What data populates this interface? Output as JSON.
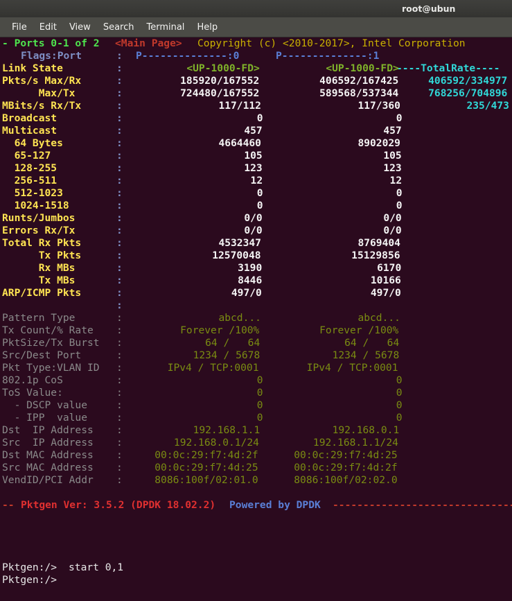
{
  "window": {
    "title": "root@ubun",
    "menu": [
      "File",
      "Edit",
      "View",
      "Search",
      "Terminal",
      "Help"
    ]
  },
  "colors": {
    "background": "#2b0a1e",
    "green": "#4ee44e",
    "yellow": "#ffe452",
    "cyan": "#30d7d7",
    "white": "#f4f4f4",
    "olive": "#c9b100",
    "gray": "#8a8a8a",
    "red": "#c0392b",
    "blue": "#5a7fd6"
  },
  "header": {
    "ports": "- Ports 0-1 of 2",
    "page": "<Main Page>",
    "copyright": "Copyright (c) <2010-2017>, Intel Corporation"
  },
  "flags": {
    "label": "Flags:Port",
    "colon": ":",
    "port0": "P--------------:0",
    "port1": "P--------------:1"
  },
  "columns": {
    "total_rate_header": "----TotalRate----"
  },
  "stats": [
    {
      "label": "Link State",
      "colon": ":",
      "p0": "<UP-1000-FD>",
      "p1": "<UP-1000-FD>",
      "total": "",
      "label_class": "c-yellow",
      "value_class": "c-grn2"
    },
    {
      "label": "Pkts/s Max/Rx",
      "colon": ":",
      "p0": "185920/167552",
      "p1": "406592/167425",
      "total": "406592/334977",
      "label_class": "c-yellow",
      "value_class": "c-white"
    },
    {
      "label": "      Max/Tx",
      "colon": ":",
      "p0": "724480/167552",
      "p1": "589568/537344",
      "total": "768256/704896",
      "label_class": "c-yellow",
      "value_class": "c-white"
    },
    {
      "label": "MBits/s Rx/Tx",
      "colon": ":",
      "p0": "117/112",
      "p1": "117/360",
      "total": "235/473",
      "label_class": "c-yellow",
      "value_class": "c-white"
    },
    {
      "label": "Broadcast",
      "colon": ":",
      "p0": "0",
      "p1": "0",
      "total": "",
      "label_class": "c-yellow",
      "value_class": "c-white"
    },
    {
      "label": "Multicast",
      "colon": ":",
      "p0": "457",
      "p1": "457",
      "total": "",
      "label_class": "c-yellow",
      "value_class": "c-white"
    },
    {
      "label": "  64 Bytes",
      "colon": ":",
      "p0": "4664460",
      "p1": "8902029",
      "total": "",
      "label_class": "c-yellow",
      "value_class": "c-white"
    },
    {
      "label": "  65-127",
      "colon": ":",
      "p0": "105",
      "p1": "105",
      "total": "",
      "label_class": "c-yellow",
      "value_class": "c-white"
    },
    {
      "label": "  128-255",
      "colon": ":",
      "p0": "123",
      "p1": "123",
      "total": "",
      "label_class": "c-yellow",
      "value_class": "c-white"
    },
    {
      "label": "  256-511",
      "colon": ":",
      "p0": "12",
      "p1": "12",
      "total": "",
      "label_class": "c-yellow",
      "value_class": "c-white"
    },
    {
      "label": "  512-1023",
      "colon": ":",
      "p0": "0",
      "p1": "0",
      "total": "",
      "label_class": "c-yellow",
      "value_class": "c-white"
    },
    {
      "label": "  1024-1518",
      "colon": ":",
      "p0": "0",
      "p1": "0",
      "total": "",
      "label_class": "c-yellow",
      "value_class": "c-white"
    },
    {
      "label": "Runts/Jumbos",
      "colon": ":",
      "p0": "0/0",
      "p1": "0/0",
      "total": "",
      "label_class": "c-yellow",
      "value_class": "c-white"
    },
    {
      "label": "Errors Rx/Tx",
      "colon": ":",
      "p0": "0/0",
      "p1": "0/0",
      "total": "",
      "label_class": "c-yellow",
      "value_class": "c-white"
    },
    {
      "label": "Total Rx Pkts",
      "colon": ":",
      "p0": "4532347",
      "p1": "8769404",
      "total": "",
      "label_class": "c-yellow",
      "value_class": "c-white"
    },
    {
      "label": "      Tx Pkts",
      "colon": ":",
      "p0": "12570048",
      "p1": "15129856",
      "total": "",
      "label_class": "c-yellow",
      "value_class": "c-white"
    },
    {
      "label": "      Rx MBs",
      "colon": ":",
      "p0": "3190",
      "p1": "6170",
      "total": "",
      "label_class": "c-yellow",
      "value_class": "c-white"
    },
    {
      "label": "      Tx MBs",
      "colon": ":",
      "p0": "8446",
      "p1": "10166",
      "total": "",
      "label_class": "c-yellow",
      "value_class": "c-white"
    },
    {
      "label": "ARP/ICMP Pkts",
      "colon": ":",
      "p0": "497/0",
      "p1": "497/0",
      "total": "",
      "label_class": "c-yellow",
      "value_class": "c-white"
    },
    {
      "label": "",
      "colon": ":",
      "p0": "",
      "p1": "",
      "total": "",
      "label_class": "c-yellow",
      "value_class": "c-white"
    },
    {
      "label": "Pattern Type",
      "colon": ":",
      "p0": "abcd...",
      "p1": "abcd...",
      "total": "",
      "label_class": "c-gray",
      "value_class": "c-dkgreen"
    },
    {
      "label": "Tx Count/% Rate",
      "colon": ":",
      "p0": "Forever /100%",
      "p1": "Forever /100%",
      "total": "",
      "label_class": "c-gray",
      "value_class": "c-dkgreen"
    },
    {
      "label": "PktSize/Tx Burst",
      "colon": ":",
      "p0": "  64 /   64",
      "p1": "  64 /   64",
      "total": "",
      "label_class": "c-gray",
      "value_class": "c-dkgreen"
    },
    {
      "label": "Src/Dest Port",
      "colon": ":",
      "p0": "1234 / 5678",
      "p1": "1234 / 5678",
      "total": "",
      "label_class": "c-gray",
      "value_class": "c-dkgreen"
    },
    {
      "label": "Pkt Type:VLAN ID",
      "colon": ":",
      "p0": "IPv4 / TCP:0001",
      "p1": "IPv4 / TCP:0001",
      "total": "",
      "label_class": "c-gray",
      "value_class": "c-dkgreen"
    },
    {
      "label": "802.1p CoS",
      "colon": ":",
      "p0": "0",
      "p1": "0",
      "total": "",
      "label_class": "c-gray",
      "value_class": "c-dkgreen"
    },
    {
      "label": "ToS Value:",
      "colon": ":",
      "p0": "0",
      "p1": "0",
      "total": "",
      "label_class": "c-gray",
      "value_class": "c-dkgreen"
    },
    {
      "label": "  - DSCP value",
      "colon": ":",
      "p0": "0",
      "p1": "0",
      "total": "",
      "label_class": "c-gray",
      "value_class": "c-dkgreen"
    },
    {
      "label": "  - IPP  value",
      "colon": ":",
      "p0": "0",
      "p1": "0",
      "total": "",
      "label_class": "c-gray",
      "value_class": "c-dkgreen"
    },
    {
      "label": "Dst  IP Address",
      "colon": ":",
      "p0": "192.168.1.1",
      "p1": "192.168.0.1",
      "total": "",
      "label_class": "c-gray",
      "value_class": "c-dkgreen"
    },
    {
      "label": "Src  IP Address",
      "colon": ":",
      "p0": "192.168.0.1/24",
      "p1": "192.168.1.1/24",
      "total": "",
      "label_class": "c-gray",
      "value_class": "c-dkgreen"
    },
    {
      "label": "Dst MAC Address",
      "colon": ":",
      "p0": "00:0c:29:f7:4d:2f",
      "p1": "00:0c:29:f7:4d:25",
      "total": "",
      "label_class": "c-gray",
      "value_class": "c-dkgreen"
    },
    {
      "label": "Src MAC Address",
      "colon": ":",
      "p0": "00:0c:29:f7:4d:25",
      "p1": "00:0c:29:f7:4d:2f",
      "total": "",
      "label_class": "c-gray",
      "value_class": "c-dkgreen"
    },
    {
      "label": "VendID/PCI Addr",
      "colon": ":",
      "p0": "8086:100f/02:01.0",
      "p1": "8086:100f/02:02.0",
      "total": "",
      "label_class": "c-gray",
      "value_class": "c-dkgreen"
    }
  ],
  "footer": {
    "prefix": "-- ",
    "version": "Pktgen Ver: 3.5.2 (DPDK 18.02.2)",
    "powered": "Powered by DPDK",
    "rule": "---------------------------------------"
  },
  "console": {
    "prompt1": "Pktgen:/>",
    "command1": "start 0,1",
    "prompt2": "Pktgen:/>",
    "command2": ""
  }
}
